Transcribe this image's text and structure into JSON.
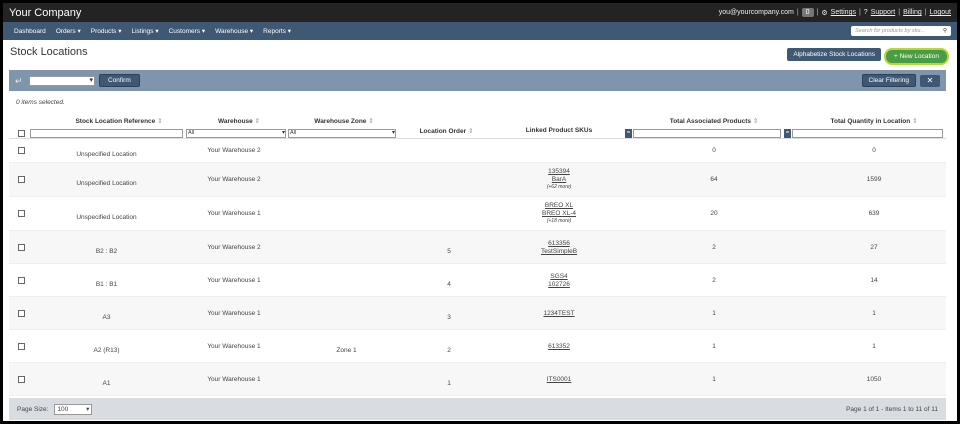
{
  "app": {
    "brand": "Your Company"
  },
  "user": {
    "email": "you@yourcompany.com",
    "badge": "0",
    "settings": "Settings",
    "support": "Support",
    "billing": "Billing",
    "logout": "Logout"
  },
  "nav": {
    "items": [
      "Dashboard",
      "Orders ▾",
      "Products ▾",
      "Listings ▾",
      "Customers ▾",
      "Warehouse ▾",
      "Reports ▾"
    ],
    "search_placeholder": "Search for products by sku..."
  },
  "page": {
    "title": "Stock Locations",
    "alphabetize_label": "Alphabetize Stock Locations",
    "new_location_label": "+ New Location"
  },
  "toolbar": {
    "confirm_label": "Confirm",
    "clear_filter_label": "Clear Filtering"
  },
  "selection_info": "0 items selected.",
  "grid": {
    "columns": {
      "ref": "Stock Location Reference",
      "warehouse": "Warehouse",
      "zone": "Warehouse Zone",
      "order": "Location Order",
      "skus": "Linked Product SKUs",
      "total_products": "Total Associated Products",
      "total_qty": "Total Quantity in Location"
    },
    "filters": {
      "warehouse": "All",
      "zone": "All",
      "products_btn": "=",
      "qty_btn": "="
    },
    "rows": [
      {
        "ref": "Unspecified Location",
        "warehouse": "Your Warehouse 2",
        "zone": "",
        "order": "",
        "skus": [],
        "more": "",
        "products": "0",
        "qty": "0"
      },
      {
        "ref": "Unspecified Location",
        "warehouse": "Your Warehouse 2",
        "zone": "",
        "order": "",
        "skus": [
          "135394",
          "BarA"
        ],
        "more": "(+62 more)",
        "products": "64",
        "qty": "1599"
      },
      {
        "ref": "Unspecified Location",
        "warehouse": "Your Warehouse 1",
        "zone": "",
        "order": "",
        "skus": [
          "BREO XL",
          "BREO XL-4"
        ],
        "more": "(+18 more)",
        "products": "20",
        "qty": "639"
      },
      {
        "ref": "B2 : B2",
        "warehouse": "Your Warehouse 2",
        "zone": "",
        "order": "5",
        "skus": [
          "613356",
          "TestSimpleB"
        ],
        "more": "",
        "products": "2",
        "qty": "27"
      },
      {
        "ref": "B1 : B1",
        "warehouse": "Your Warehouse 1",
        "zone": "",
        "order": "4",
        "skus": [
          "SGS4",
          "102726"
        ],
        "more": "",
        "products": "2",
        "qty": "14"
      },
      {
        "ref": "A3",
        "warehouse": "Your Warehouse 1",
        "zone": "",
        "order": "3",
        "skus": [
          "1234TEST"
        ],
        "more": "",
        "products": "1",
        "qty": "1"
      },
      {
        "ref": "A2 (R13)",
        "warehouse": "Your Warehouse 1",
        "zone": "Zone 1",
        "order": "2",
        "skus": [
          "613352"
        ],
        "more": "",
        "products": "1",
        "qty": "1"
      },
      {
        "ref": "A1",
        "warehouse": "Your Warehouse 1",
        "zone": "",
        "order": "1",
        "skus": [
          "ITS0001"
        ],
        "more": "",
        "products": "1",
        "qty": "1050"
      }
    ]
  },
  "footer": {
    "page_size_label": "Page Size:",
    "page_size": "100",
    "pager_text": "Page 1 of 1 - Items 1 to 11 of 11"
  }
}
